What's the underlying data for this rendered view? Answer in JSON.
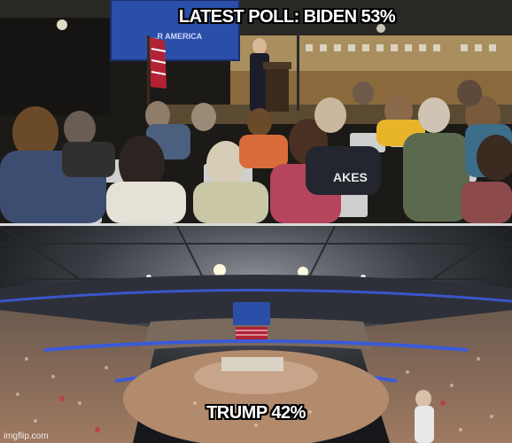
{
  "meme": {
    "top_caption": "LATEST POLL: BIDEN 53%",
    "bottom_caption": "TRUMP 42%",
    "watermark": "imgflip.com",
    "banner_text_line1": "...R AMERICA",
    "shirt_text": "AKES"
  },
  "colors": {
    "caption_text": "#ffffff",
    "caption_outline": "#000000",
    "arena_blue": "#3a5bd8",
    "stage_banner": "#2b4ea8"
  }
}
